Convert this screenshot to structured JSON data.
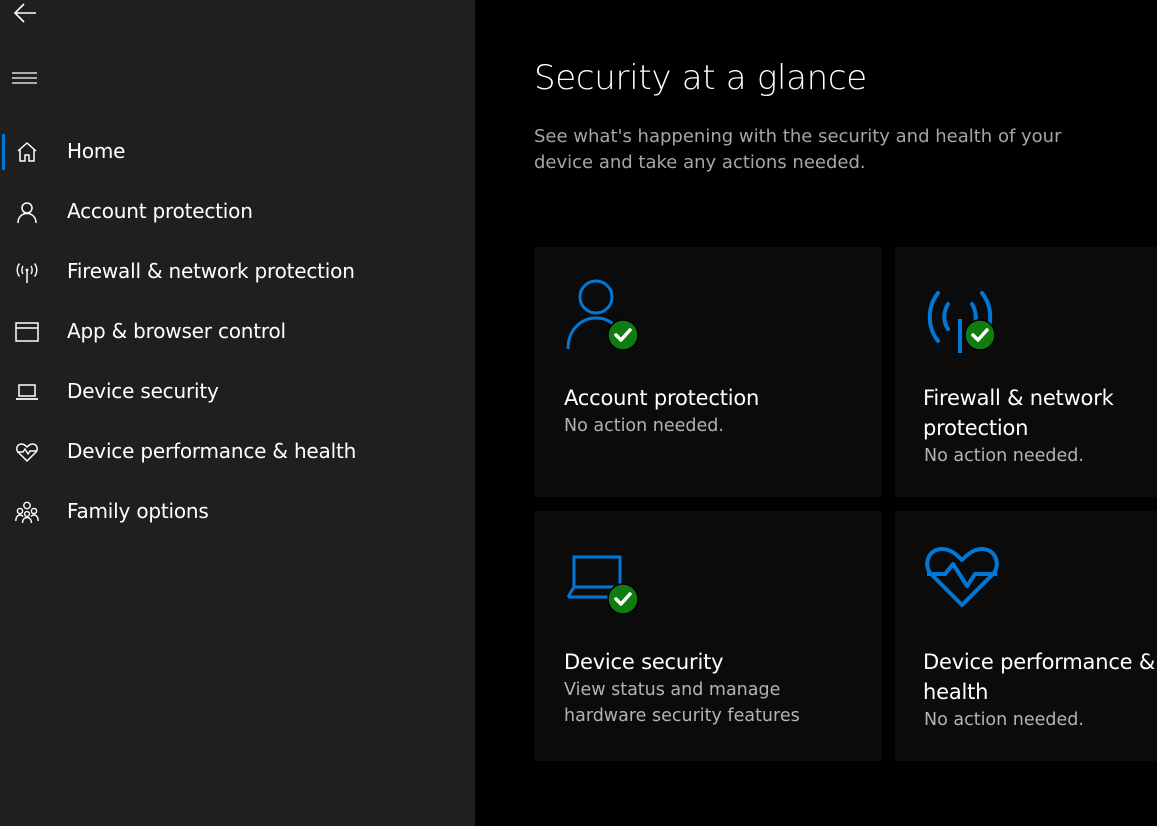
{
  "sidebar": {
    "items": [
      {
        "label": "Home",
        "icon": "home-icon",
        "selected": true
      },
      {
        "label": "Account protection",
        "icon": "person-icon"
      },
      {
        "label": "Firewall & network protection",
        "icon": "antenna-icon"
      },
      {
        "label": "App & browser control",
        "icon": "browser-window-icon"
      },
      {
        "label": "Device security",
        "icon": "laptop-icon"
      },
      {
        "label": "Device performance & health",
        "icon": "heart-pulse-icon"
      },
      {
        "label": "Family options",
        "icon": "family-icon"
      }
    ]
  },
  "main": {
    "title": "Security at a glance",
    "description": "See what's happening with the security and health of your device and take any actions needed."
  },
  "tiles": [
    {
      "title": "Account protection",
      "status": "No action needed.",
      "icon": "person-icon",
      "badge": "check-badge-icon"
    },
    {
      "title": "Firewall & network protection",
      "status": "No action needed.",
      "icon": "antenna-icon",
      "badge": "check-badge-icon"
    },
    {
      "title": "Device security",
      "status": "View status and manage hardware security features",
      "icon": "laptop-icon",
      "badge": "check-badge-icon"
    },
    {
      "title": "Device performance & health",
      "status": "No action needed.",
      "icon": "heart-pulse-icon"
    }
  ],
  "colors": {
    "accent": "#0078d7",
    "success": "#107c10",
    "sidebar_bg": "#1f1f1f",
    "main_bg": "#000000",
    "tile_bg": "#0b0b0b"
  }
}
